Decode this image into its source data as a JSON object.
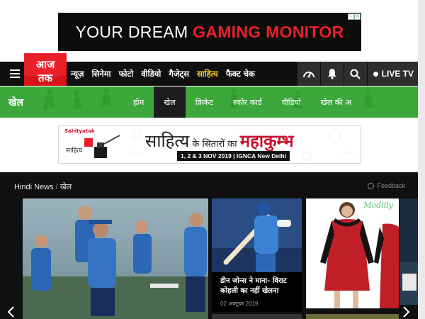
{
  "ad_top": {
    "text_plain": "YOUR DREAM ",
    "text_accent": "GAMING MONITOR",
    "badge_info": "i",
    "badge_close": "✕"
  },
  "nav": {
    "logo_text": "आज तक",
    "links": [
      "न्यूज़",
      "सिनेमा",
      "फोटो",
      "वीडियो",
      "गैजेट्स",
      "साहित्य",
      "फैक्ट चेक"
    ],
    "active_index": 5,
    "live_tv": "LIVE TV",
    "icons": [
      "speedometer-icon",
      "bell-icon",
      "search-icon"
    ]
  },
  "section": {
    "title": "खेल",
    "links": [
      "होम",
      "खेल",
      "क्रिकेट",
      "स्कोर कार्ड",
      "वीडियो",
      "खेल की अ"
    ],
    "active_index": 1
  },
  "ad_sahitya": {
    "brand": "Sahityatak",
    "logo_sub": "साहित्य",
    "headline_big": "साहित्य",
    "headline_mid": " के सितारों का ",
    "headline_red": "महाकुम्भ",
    "date_line": "1, 2 & 3 NOV 2019 | IGNCA New Delhi"
  },
  "content": {
    "breadcrumb_home": "Hindi News",
    "breadcrumb_sep": "/",
    "breadcrumb_current": "खेल",
    "feedback": "Feedback",
    "card1_title": "डीन जोन्स ने माना- विराट कोहली का नहीं खेलना",
    "card1_date": "02 अक्टूबर 2019",
    "card2_label": "Modlily"
  },
  "colors": {
    "nav_bg": "#0f0f0f",
    "section_green": "#3ca83b",
    "active_yellow": "#f4d21f",
    "accent_red": "#e8202a"
  }
}
